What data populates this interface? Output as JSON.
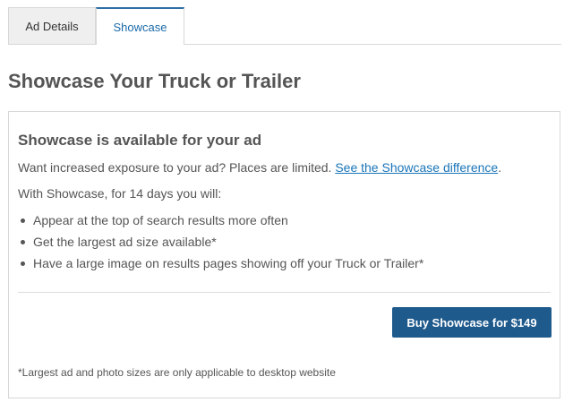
{
  "tabs": [
    {
      "label": "Ad Details"
    },
    {
      "label": "Showcase"
    }
  ],
  "page_title": "Showcase Your Truck or Trailer",
  "panel": {
    "heading": "Showcase is available for your ad",
    "intro_text": "Want increased exposure to your ad? Places are limited. ",
    "intro_link": "See the Showcase difference",
    "intro_end": ".",
    "lead": "With Showcase, for 14 days you will:",
    "benefits": [
      "Appear at the top of search results more often",
      "Get the largest ad size available*",
      "Have a large image on results pages showing off your Truck or Trailer*"
    ],
    "buy_label": "Buy Showcase for $149",
    "footnote": "*Largest ad and photo sizes are only applicable to desktop website"
  },
  "colors": {
    "accent": "#1f5a8c",
    "link": "#1a75b8",
    "tab_active_text": "#1a6aa9"
  }
}
